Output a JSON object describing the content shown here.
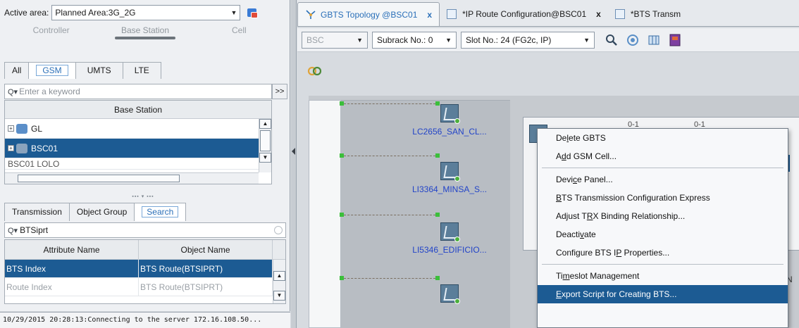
{
  "left": {
    "active_area_label": "Active area:",
    "active_area_value": "Planned Area:3G_2G",
    "scope_tabs": [
      "Controller",
      "Base Station",
      "Cell"
    ],
    "net_tabs": [
      "All",
      "GSM",
      "UMTS",
      "LTE"
    ],
    "search_placeholder": "Enter a keyword",
    "more_label": ">>",
    "tree_header": "Base Station",
    "tree_rows": [
      "GL",
      "BSC01",
      "BSC01 LOLO"
    ],
    "bottom_tabs": [
      "Transmission",
      "Object Group",
      "Search"
    ],
    "search_value": "BTSiprt",
    "attr_headers": [
      "Attribute Name",
      "Object Name"
    ],
    "attr_rows": [
      {
        "attr": "BTS Index",
        "obj": "BTS Route(BTSIPRT)"
      },
      {
        "attr": "Route Index",
        "obj": "BTS Route(BTSIPRT)"
      }
    ],
    "status_text": "10/29/2015 20:28:13:Connecting to the server 172.16.108.50..."
  },
  "right": {
    "doc_tabs": [
      {
        "label": "GBTS Topology @BSC01",
        "close": "x"
      },
      {
        "label": "*IP Route Configuration@BSC01",
        "close": "x"
      },
      {
        "label": "*BTS Transm"
      }
    ],
    "toolbar": {
      "bsc_select": "BSC",
      "subrack_select": "Subrack No.: 0",
      "slot_select": "Slot No.: 24 (FG2c, IP)"
    },
    "nodes": [
      "LC2656_SAN_CL...",
      "LI3364_MINSA_S...",
      "LI5346_EDIFICIO...",
      ""
    ],
    "card_labels": [
      "0-1",
      "0-1"
    ],
    "edge_fragments": [
      "N"
    ],
    "context_menu": {
      "items": [
        {
          "pre": "De",
          "ul": "l",
          "post": "ete GBTS"
        },
        {
          "pre": "A",
          "ul": "d",
          "post": "d GSM Cell..."
        },
        {
          "pre": "Devi",
          "ul": "c",
          "post": "e Panel..."
        },
        {
          "pre": "",
          "ul": "B",
          "post": "TS Transmission Configuration Express"
        },
        {
          "pre": "Adjust T",
          "ul": "R",
          "post": "X Binding Relationship..."
        },
        {
          "pre": "Deacti",
          "ul": "v",
          "post": "ate"
        },
        {
          "pre": "Configure BTS I",
          "ul": "P",
          "post": " Properties..."
        },
        {
          "pre": "Ti",
          "ul": "m",
          "post": "eslot Management"
        },
        {
          "pre": "",
          "ul": "E",
          "post": "xport Script for Creating BTS..."
        }
      ]
    }
  }
}
